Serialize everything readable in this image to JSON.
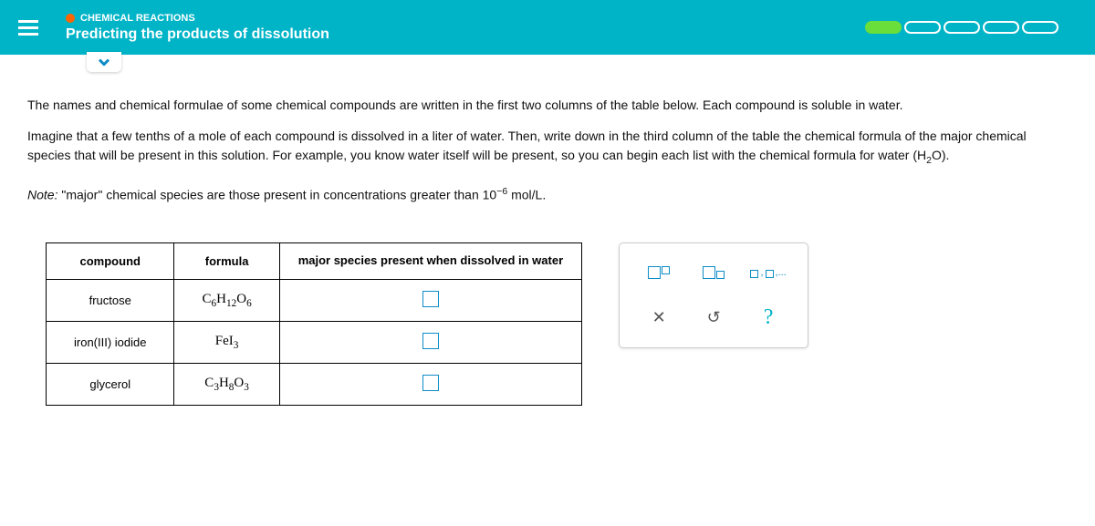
{
  "header": {
    "breadcrumb": "CHEMICAL REACTIONS",
    "title": "Predicting the products of dissolution"
  },
  "problem": {
    "p1": "The names and chemical formulae of some chemical compounds are written in the first two columns of the table below. Each compound is soluble in water.",
    "p2_pre": "Imagine that a few tenths of a mole of each compound is dissolved in a liter of water. Then, write down in the third column of the table the chemical formula of the major chemical species that will be present in this solution. For example, you know water itself will be present, so you can begin each list with the chemical formula for water (H",
    "h2o_sub": "2",
    "p2_post": "O).",
    "note_label": "Note:",
    "note_pre": " \"major\" chemical species are those present in concentrations greater than 10",
    "note_super": "−6",
    "note_post": " mol/L."
  },
  "table": {
    "headers": {
      "compound": "compound",
      "formula": "formula",
      "species": "major species present when dissolved in water"
    },
    "rows": [
      {
        "compound": "fructose",
        "formula_html": "C<sub>6</sub>H<sub>12</sub>O<sub>6</sub>"
      },
      {
        "compound": "iron(III) iodide",
        "formula_html": "FeI<sub>3</sub>"
      },
      {
        "compound": "glycerol",
        "formula_html": "C<sub>3</sub>H<sub>8</sub>O<sub>3</sub>"
      }
    ]
  },
  "toolbox": {
    "list_label": ",...",
    "help": "?"
  }
}
